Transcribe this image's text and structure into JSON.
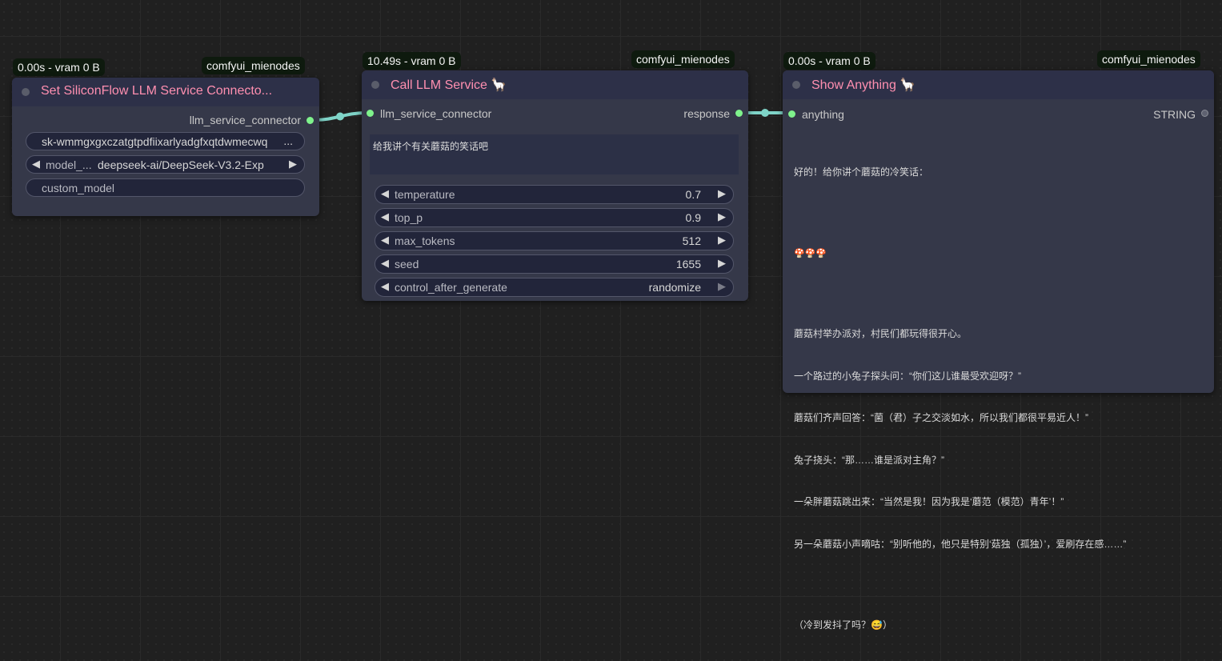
{
  "colors": {
    "link": "#7fd4c8",
    "slot_active": "#7ff28c",
    "title": "#ff8fb0",
    "badge_bg": "#0e1a0e"
  },
  "node1": {
    "badge_time": "0.00s - vram 0 B",
    "badge_pack": "comfyui_mienodes",
    "title": "Set SiliconFlow LLM Service Connecto...",
    "output_label": "llm_service_connector",
    "api_key": "sk-wmmgxgxczatgtpdfiixarlyadgfxqtdwmecwq",
    "api_key_more": "...",
    "model_label": "model_...",
    "model_value": "deepseek-ai/DeepSeek-V3.2-Exp",
    "custom_model_placeholder": "custom_model"
  },
  "node2": {
    "badge_time": "10.49s - vram 0 B",
    "badge_pack": "comfyui_mienodes",
    "title": "Call LLM Service 🦙",
    "input_label": "llm_service_connector",
    "output_label": "response",
    "prompt": "给我讲个有关蘑菇的笑话吧",
    "widgets": [
      {
        "label": "temperature",
        "value": "0.7"
      },
      {
        "label": "top_p",
        "value": "0.9"
      },
      {
        "label": "max_tokens",
        "value": "512"
      },
      {
        "label": "seed",
        "value": "1655"
      },
      {
        "label": "control_after_generate",
        "value": "randomize"
      }
    ]
  },
  "node3": {
    "badge_time": "0.00s - vram 0 B",
    "badge_pack": "comfyui_mienodes",
    "title": "Show Anything 🦙",
    "input_label": "anything",
    "output_label": "STRING",
    "lines": [
      "好的！给你讲个蘑菇的冷笑话：",
      "",
      "🍄🍄🍄",
      "",
      "蘑菇村举办派对，村民们都玩得很开心。",
      "一个路过的小兔子探头问：“你们这儿谁最受欢迎呀？”",
      "蘑菇们齐声回答：“菌（君）子之交淡如水，所以我们都很平易近人！”",
      "兔子挠头：“那……谁是派对主角？”",
      "一朵胖蘑菇跳出来：“当然是我！因为我是‘蘑范（模范）青年’！”",
      "另一朵蘑菇小声嘀咕：“别听他的，他只是特别‘菇独（孤独）’，爱刷存在感……”",
      "",
      "（冷到发抖了吗？😅）"
    ]
  }
}
